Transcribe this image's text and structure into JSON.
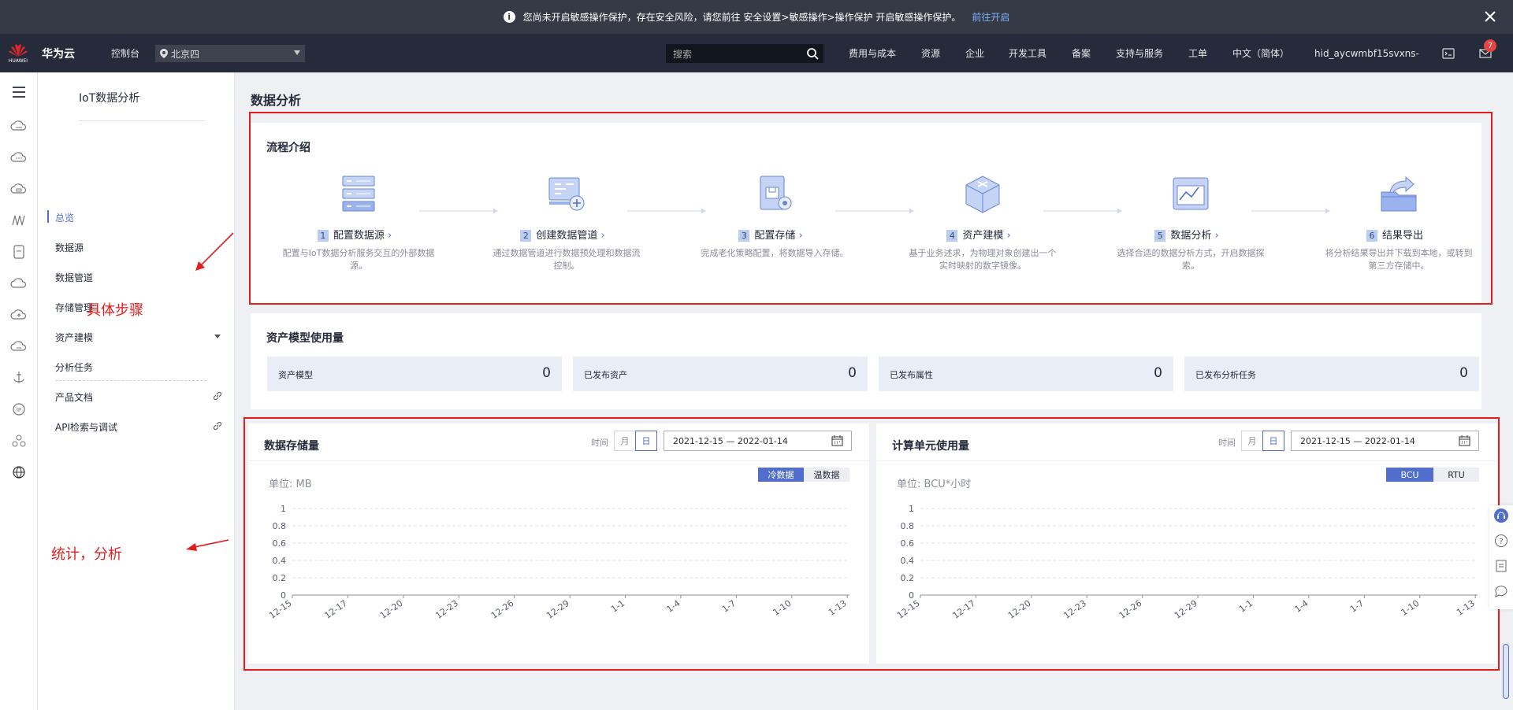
{
  "banner": {
    "message": "您尚未开启敏感操作保护，存在安全风险，请您前往 安全设置>敏感操作>操作保护 开启敏感操作保护。",
    "link": "前往开启",
    "info_icon": "info-icon",
    "close_icon": "close-icon"
  },
  "topnav": {
    "logo_text": "HUAWEI",
    "brand": "华为云",
    "console": "控制台",
    "region": "北京四",
    "search_placeholder": "搜索",
    "items": [
      "费用与成本",
      "资源",
      "企业",
      "开发工具",
      "备案",
      "支持与服务",
      "工单",
      "中文（简体）"
    ],
    "user": "hid_aycwmbf15svxns-",
    "message_count": "7"
  },
  "sidebar": {
    "title": "IoT数据分析",
    "items": [
      {
        "label": "总览",
        "active": true
      },
      {
        "label": "数据源"
      },
      {
        "label": "数据管道"
      },
      {
        "label": "存储管理"
      },
      {
        "label": "资产建模"
      },
      {
        "label": "分析任务"
      },
      {
        "label": "产品文档"
      },
      {
        "label": "API检索与调试"
      }
    ]
  },
  "annotations": {
    "steps": "具体步骤",
    "stats": "统计，分析"
  },
  "page": {
    "title": "数据分析"
  },
  "flow": {
    "title": "流程介绍",
    "steps": [
      {
        "num": "1",
        "label": "配置数据源",
        "desc": "配置与IoT数据分析服务交互的外部数据源。",
        "icon": "data-source-icon"
      },
      {
        "num": "2",
        "label": "创建数据管道",
        "desc": "通过数据管道进行数据预处理和数据流控制。",
        "icon": "pipeline-icon"
      },
      {
        "num": "3",
        "label": "配置存储",
        "desc": "完成老化策略配置，将数据导入存储。",
        "icon": "storage-config-icon"
      },
      {
        "num": "4",
        "label": "资产建模",
        "desc": "基于业务述求，为物理对象创建出一个实时映射的数字镜像。",
        "icon": "asset-model-icon"
      },
      {
        "num": "5",
        "label": "数据分析",
        "desc": "选择合适的数据分析方式，开启数据探索。",
        "icon": "analysis-icon"
      },
      {
        "num": "6",
        "label": "结果导出",
        "desc": "将分析结果导出并下载到本地，或转到第三方存储中。",
        "icon": "export-icon"
      }
    ]
  },
  "usage": {
    "title": "资产模型使用量",
    "items": [
      {
        "label": "资产模型",
        "value": "0"
      },
      {
        "label": "已发布资产",
        "value": "0"
      },
      {
        "label": "已发布属性",
        "value": "0"
      },
      {
        "label": "已发布分析任务",
        "value": "0"
      }
    ]
  },
  "storage_panel": {
    "title": "数据存储量",
    "time_label": "时间",
    "month": "月",
    "day": "日",
    "date_range": "2021-12-15 — 2022-01-14",
    "unit": "单位: MB",
    "toggle_on": "冷数据",
    "toggle_off": "温数据"
  },
  "compute_panel": {
    "title": "计算单元使用量",
    "time_label": "时间",
    "month": "月",
    "day": "日",
    "date_range": "2021-12-15 — 2022-01-14",
    "unit": "单位: BCU*小时",
    "toggle_on": "BCU",
    "toggle_off": "RTU"
  },
  "chart_data": [
    {
      "type": "line",
      "title": "数据存储量",
      "ylabel": "单位: MB",
      "ylim": [
        0,
        1
      ],
      "yticks": [
        "1",
        "0.8",
        "0.6",
        "0.4",
        "0.2",
        "0"
      ],
      "x": [
        "12-15",
        "12-17",
        "12-20",
        "12-23",
        "12-26",
        "12-29",
        "1-1",
        "1-4",
        "1-7",
        "1-10",
        "1-13"
      ],
      "series": [],
      "grid": true
    },
    {
      "type": "line",
      "title": "计算单元使用量",
      "ylabel": "单位: BCU*小时",
      "ylim": [
        0,
        1
      ],
      "yticks": [
        "1",
        "0.8",
        "0.6",
        "0.4",
        "0.2",
        "0"
      ],
      "x": [
        "12-15",
        "12-17",
        "12-20",
        "12-23",
        "12-26",
        "12-29",
        "1-1",
        "1-4",
        "1-7",
        "1-10",
        "1-13"
      ],
      "series": [],
      "grid": true
    }
  ],
  "colors": {
    "accent": "#526ecc",
    "annotation": "#e11d1d",
    "topbar": "#252b3a"
  }
}
